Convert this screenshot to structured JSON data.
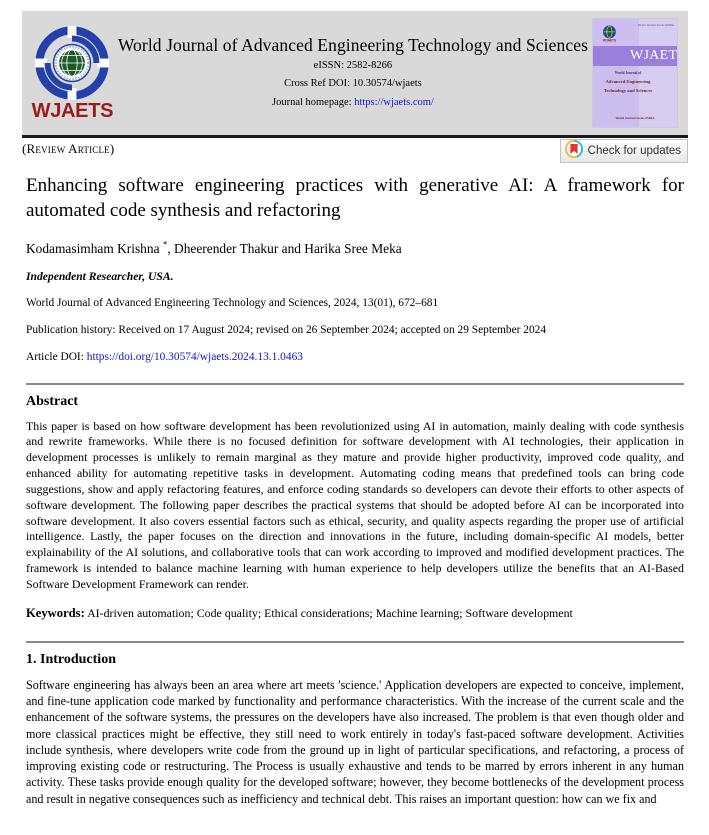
{
  "masthead": {
    "logo_word": "WJAETS",
    "journal_title": "World Journal of Advanced Engineering Technology and Sciences",
    "eissn": "eISSN: 2582-8266",
    "crossref_doi": "Cross Ref DOI: 10.30574/wjaets",
    "homepage_label": "Journal homepage:",
    "homepage_url": "https://wjaets.com/",
    "cover": {
      "wjaets": "WJAETS",
      "top_strip": "World Journal Series INDIA",
      "subtitle_small": "World Journal of",
      "subtitle": "Advanced Engineering Technology and Sciences",
      "footer": "World Journal Series INDIA"
    }
  },
  "article_type": "(Review Article)",
  "crossmark": {
    "label": "Check for updates"
  },
  "title": "Enhancing software engineering practices with generative AI: A framework for automated code synthesis and refactoring",
  "authors": "Kodamasimham Krishna , Dheerender Thakur and Harika Sree Meka",
  "authors_marker": "*",
  "affiliation": "Independent Researcher, USA.",
  "citation": "World Journal of Advanced Engineering Technology and Sciences, 2024, 13(01), 672–681",
  "publication_history": "Publication history: Received on 17 August 2024; revised on 26 September 2024; accepted on 29 September 2024",
  "doi": {
    "label": "Article DOI:",
    "url": "https://doi.org/10.30574/wjaets.2024.13.1.0463"
  },
  "abstract": {
    "heading": "Abstract",
    "body": "This paper is based on how software development has been revolutionized using AI in automation, mainly dealing with code synthesis and rewrite frameworks. While there is no focused definition for software development with AI technologies, their application in development processes is unlikely to remain marginal as they mature and provide higher productivity, improved code quality, and enhanced ability for automating repetitive tasks in development. Automating coding means that predefined tools can bring code suggestions, show and apply refactoring features, and enforce coding standards so developers can devote their efforts to other aspects of software development. The following paper describes the practical systems that should be adopted before AI can be incorporated into software development. It also covers essential factors such as ethical, security, and quality aspects regarding the proper use of artificial intelligence. Lastly, the paper focuses on the direction and innovations in the future, including domain-specific AI models, better explainability of the AI solutions, and collaborative tools that can work according to improved and modified development practices. The framework is intended to balance machine learning with human experience to help developers utilize the benefits that an AI-Based Software Development Framework can render."
  },
  "keywords": {
    "label": "Keywords:",
    "value": "AI-driven automation; Code quality; Ethical considerations; Machine learning; Software development"
  },
  "introduction": {
    "heading": "1. Introduction",
    "body": "Software engineering has always been an area where art meets 'science.' Application developers are expected to conceive, implement, and fine-tune application code marked by functionality and performance characteristics. With the increase of the current scale and the enhancement of the software systems, the pressures on the developers have also increased. The problem is that even though older and more classical practices might be effective, they still need to work entirely in today's fast-paced software development. Activities include synthesis, where developers write code from the ground up in light of particular specifications, and refactoring, a process of improving existing code or restructuring. The Process is usually exhaustive and tends to be marred by errors inherent in any human activity. These tasks provide enough quality for the developed software; however, they become bottlenecks of the development process and result in negative consequences such as inefficiency and technical debt. This raises an important question: how can we fix and"
  },
  "colors": {
    "masthead_bg": "#d9d9d9",
    "link": "#1414cc",
    "logo_red": "#9b1b1b",
    "logo_blue": "#2340ab",
    "logo_green": "#1d5a28",
    "crossmark_red": "#e4322b",
    "crossmark_yellow": "#f5b52c",
    "crossmark_cyan": "#27c0d8"
  }
}
